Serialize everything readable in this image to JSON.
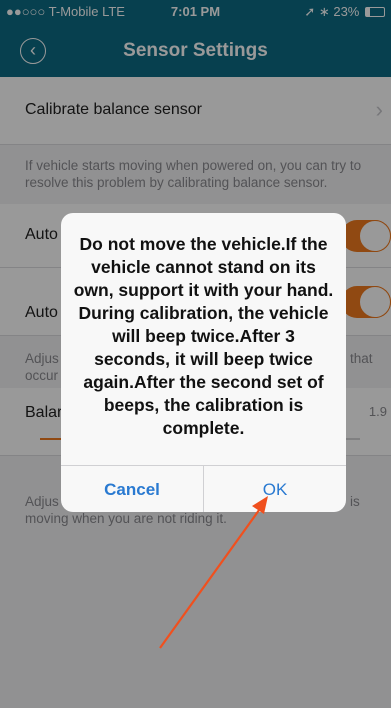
{
  "status_bar": {
    "carrier": "●●○○○ T-Mobile  LTE",
    "time": "7:01 PM",
    "battery": "23%",
    "indicators": "➚ ∗"
  },
  "header": {
    "title": "Sensor Settings",
    "back_icon": "‹"
  },
  "settings": {
    "calibrate_label": "Calibrate balance sensor",
    "calibrate_note": "If vehicle starts moving when powered on, you can try to resolve this problem by calibrating balance sensor.",
    "auto_1_label": "Auto",
    "auto_2_label": "Auto",
    "adjust_1_left": "Adjus",
    "adjust_1_left2": "occur",
    "adjust_1_right": "that",
    "balance_label": "Balar",
    "balance_value": "1.9",
    "adjust_2_text": "Adjus",
    "adjust_2_right": "is",
    "adjust_2_line2": "moving when you are not riding it."
  },
  "dialog": {
    "message": "Do not move the vehicle.If the vehicle cannot stand on its own, support it with your hand. During calibration, the vehicle will beep twice.After 3 seconds, it will beep twice again.After the second set of beeps, the calibration is complete.",
    "cancel_label": "Cancel",
    "ok_label": "OK"
  },
  "colors": {
    "header": "#0c6b84",
    "accent": "#f07b1f",
    "button_text": "#2a7ad1",
    "annotation_arrow": "#f0501e"
  }
}
